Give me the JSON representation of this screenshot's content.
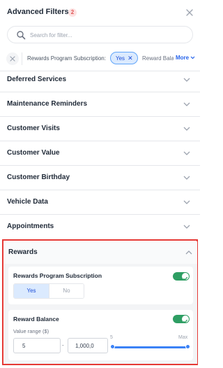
{
  "header": {
    "title": "Advanced Filters",
    "badge": "2"
  },
  "search": {
    "placeholder": "Search for filter..."
  },
  "chips": {
    "active_label": "Rewards Program Subscription:",
    "active_value": "Yes",
    "next_label": "Reward Bala",
    "more_label": "More"
  },
  "sections": [
    {
      "label": "Deferred Services"
    },
    {
      "label": "Maintenance Reminders"
    },
    {
      "label": "Customer Visits"
    },
    {
      "label": "Customer Value"
    },
    {
      "label": "Customer Birthday"
    },
    {
      "label": "Vehicle Data"
    },
    {
      "label": "Appointments"
    }
  ],
  "rewards": {
    "title": "Rewards",
    "subscription": {
      "label": "Rewards Program Subscription",
      "enabled": true,
      "yes_label": "Yes",
      "no_label": "No",
      "selected": "Yes"
    },
    "balance": {
      "label": "Reward Balance",
      "enabled": true,
      "range_label": "Value range ($)",
      "min_value": "5",
      "max_value": "1,000,0",
      "dash": "-",
      "slider_min_label": "5",
      "slider_max_label": "Max"
    }
  },
  "colors": {
    "accent": "#3b82f6",
    "toggle_on": "#2e9e63",
    "badge": "#e05555",
    "highlight_border": "#e53935"
  }
}
